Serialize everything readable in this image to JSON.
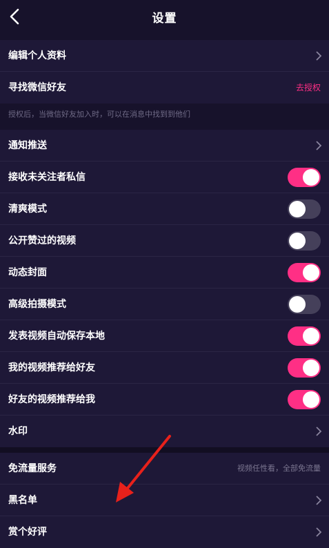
{
  "header": {
    "title": "设置"
  },
  "group1": {
    "edit_profile": "编辑个人资料",
    "find_wechat": "寻找微信好友",
    "authorize": "去授权",
    "hint": "授权后，当微信好友加入时，可以在消息中找到到他们"
  },
  "group2": {
    "push": "通知推送",
    "toggles": [
      {
        "label": "接收未关注者私信",
        "on": true
      },
      {
        "label": "清爽模式",
        "on": false
      },
      {
        "label": "公开赞过的视频",
        "on": false
      },
      {
        "label": "动态封面",
        "on": true
      },
      {
        "label": "高级拍摄模式",
        "on": false
      },
      {
        "label": "发表视频自动保存本地",
        "on": true
      },
      {
        "label": "我的视频推荐给好友",
        "on": true
      },
      {
        "label": "好友的视频推荐给我",
        "on": true
      }
    ],
    "watermark": "水印"
  },
  "group3": {
    "free_data": "免流量服务",
    "free_data_desc": "视频任性看，全部免流量",
    "blacklist": "黑名单",
    "rate": "赏个好评"
  },
  "colors": {
    "accent": "#ff2f85",
    "background": "#17122b",
    "row": "#1e1837",
    "annotation_arrow": "#e8211b"
  }
}
